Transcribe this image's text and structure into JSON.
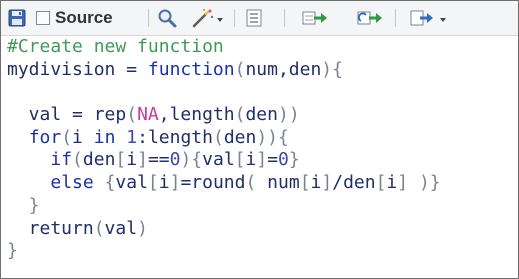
{
  "toolbar": {
    "source_label": "Source",
    "icons": [
      "save-icon",
      "checkbox-icon",
      "search-icon",
      "magic-wand-icon",
      "outline-icon",
      "run-line-icon",
      "rerun-icon",
      "source-run-icon"
    ]
  },
  "colors": {
    "comment": "#3f9a58",
    "identifier": "#1e2f6b",
    "keyword": "#1a2fb0",
    "punctuation": "#7b8391",
    "number": "#3a48b8",
    "constant": "#c53c9e"
  },
  "code": {
    "lines": [
      [
        {
          "t": "#Create new function",
          "c": "comment"
        }
      ],
      [
        {
          "t": "mydivision = ",
          "c": "ident"
        },
        {
          "t": "function",
          "c": "kw"
        },
        {
          "t": "(",
          "c": "punct"
        },
        {
          "t": "num,den",
          "c": "ident"
        },
        {
          "t": "){",
          "c": "punct"
        }
      ],
      [
        {
          "t": "",
          "c": "ident"
        }
      ],
      [
        {
          "t": "  val = ",
          "c": "ident"
        },
        {
          "t": "rep",
          "c": "ident"
        },
        {
          "t": "(",
          "c": "punct"
        },
        {
          "t": "NA",
          "c": "const"
        },
        {
          "t": ",",
          "c": "ident"
        },
        {
          "t": "length",
          "c": "ident"
        },
        {
          "t": "(",
          "c": "punct"
        },
        {
          "t": "den",
          "c": "ident"
        },
        {
          "t": "))",
          "c": "punct"
        }
      ],
      [
        {
          "t": "  ",
          "c": "ident"
        },
        {
          "t": "for",
          "c": "kw"
        },
        {
          "t": "(",
          "c": "punct"
        },
        {
          "t": "i ",
          "c": "ident"
        },
        {
          "t": "in",
          "c": "kw"
        },
        {
          "t": " ",
          "c": "ident"
        },
        {
          "t": "1",
          "c": "num"
        },
        {
          "t": ":length",
          "c": "ident"
        },
        {
          "t": "(",
          "c": "punct"
        },
        {
          "t": "den",
          "c": "ident"
        },
        {
          "t": ")){",
          "c": "punct"
        }
      ],
      [
        {
          "t": "    ",
          "c": "ident"
        },
        {
          "t": "if",
          "c": "kw"
        },
        {
          "t": "(",
          "c": "punct"
        },
        {
          "t": "den",
          "c": "ident"
        },
        {
          "t": "[",
          "c": "punct"
        },
        {
          "t": "i",
          "c": "ident"
        },
        {
          "t": "]",
          "c": "punct"
        },
        {
          "t": "==",
          "c": "ident"
        },
        {
          "t": "0",
          "c": "num"
        },
        {
          "t": "){",
          "c": "punct"
        },
        {
          "t": "val",
          "c": "ident"
        },
        {
          "t": "[",
          "c": "punct"
        },
        {
          "t": "i",
          "c": "ident"
        },
        {
          "t": "]",
          "c": "punct"
        },
        {
          "t": "=",
          "c": "ident"
        },
        {
          "t": "0",
          "c": "num"
        },
        {
          "t": "}",
          "c": "punct"
        }
      ],
      [
        {
          "t": "    ",
          "c": "ident"
        },
        {
          "t": "else",
          "c": "kw"
        },
        {
          "t": " ",
          "c": "ident"
        },
        {
          "t": "{",
          "c": "punct"
        },
        {
          "t": "val",
          "c": "ident"
        },
        {
          "t": "[",
          "c": "punct"
        },
        {
          "t": "i",
          "c": "ident"
        },
        {
          "t": "]",
          "c": "punct"
        },
        {
          "t": "=round",
          "c": "ident"
        },
        {
          "t": "( ",
          "c": "punct"
        },
        {
          "t": "num",
          "c": "ident"
        },
        {
          "t": "[",
          "c": "punct"
        },
        {
          "t": "i",
          "c": "ident"
        },
        {
          "t": "]",
          "c": "punct"
        },
        {
          "t": "/",
          "c": "ident"
        },
        {
          "t": "den",
          "c": "ident"
        },
        {
          "t": "[",
          "c": "punct"
        },
        {
          "t": "i",
          "c": "ident"
        },
        {
          "t": "] )}",
          "c": "punct"
        }
      ],
      [
        {
          "t": "  }",
          "c": "punct"
        }
      ],
      [
        {
          "t": "  return",
          "c": "ident"
        },
        {
          "t": "(",
          "c": "punct"
        },
        {
          "t": "val",
          "c": "ident"
        },
        {
          "t": ")",
          "c": "punct"
        }
      ],
      [
        {
          "t": "}",
          "c": "punct"
        }
      ]
    ]
  }
}
